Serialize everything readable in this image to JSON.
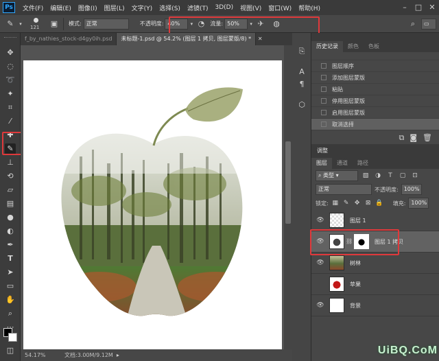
{
  "app": {
    "logo": "Ps"
  },
  "menus": [
    "文件(F)",
    "编辑(E)",
    "图像(I)",
    "图层(L)",
    "文字(Y)",
    "选择(S)",
    "滤镜(T)",
    "3D(D)",
    "视图(V)",
    "窗口(W)",
    "帮助(H)"
  ],
  "options": {
    "brush_size": "121",
    "mode_label": "模式:",
    "mode_value": "正常",
    "opacity_label": "不透明度:",
    "opacity_value": "40%",
    "flow_label": "流量:",
    "flow_value": "50%"
  },
  "tabs": [
    {
      "label": "f_by_nathies_stock-d4gy0ih.psd",
      "active": false
    },
    {
      "label": "未标题-1.psd @ 54.2% (图层 1 拷贝, 图层蒙版/8) *",
      "active": true
    }
  ],
  "status": {
    "zoom": "54.17%",
    "doc": "文档:3.00M/9.12M"
  },
  "history": {
    "tabs": [
      "历史记录",
      "颜色",
      "色板"
    ],
    "items": [
      {
        "label": "图层顺序",
        "selected": false
      },
      {
        "label": "添加图层蒙版",
        "selected": false
      },
      {
        "label": "粘贴",
        "selected": false
      },
      {
        "label": "停用图层蒙版",
        "selected": false
      },
      {
        "label": "启用图层蒙版",
        "selected": false
      },
      {
        "label": "取消选择",
        "selected": true
      }
    ]
  },
  "adjust": {
    "title": "调整"
  },
  "layers": {
    "tabs": [
      "图层",
      "通道",
      "路径"
    ],
    "filter_label": "类型",
    "blend_mode": "正常",
    "opacity_label": "不透明度:",
    "opacity_value": "100%",
    "lock_label": "锁定:",
    "fill_label": "填充:",
    "fill_value": "100%",
    "items": [
      {
        "name": "图层 1",
        "visible": true,
        "selected": false
      },
      {
        "name": "图层 1 拷贝",
        "visible": true,
        "selected": true
      },
      {
        "name": "树林",
        "visible": true,
        "selected": false
      },
      {
        "name": "苹果",
        "visible": false,
        "selected": false
      },
      {
        "name": "背景",
        "visible": true,
        "selected": false
      }
    ]
  },
  "watermark": "UiBQ.CoM",
  "colors": {
    "accent": "#31a8ff",
    "highlight": "#e0393b"
  }
}
